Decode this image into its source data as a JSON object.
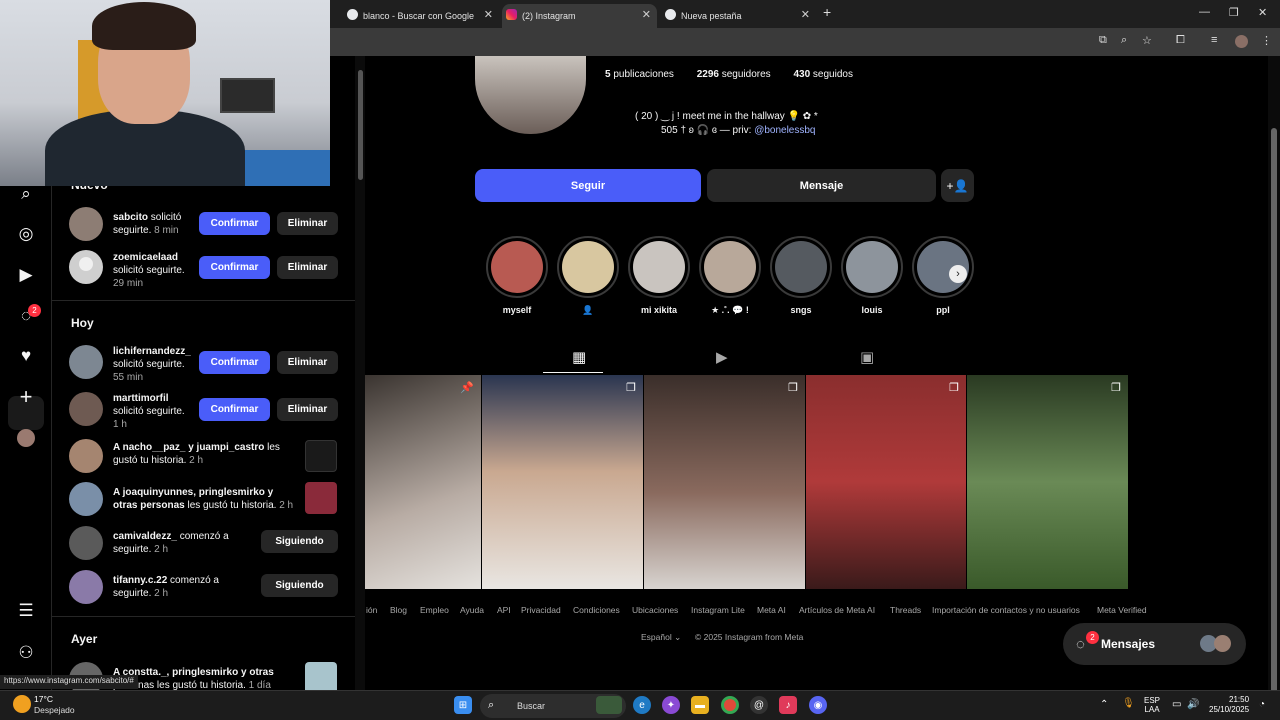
{
  "browser": {
    "tabs": [
      {
        "title": "blanco - Buscar con Google"
      },
      {
        "title": "(2) Instagram"
      },
      {
        "title": "Nueva pestaña"
      }
    ],
    "status_url": "https://www.instagram.com/sabcito/#"
  },
  "nav": {
    "notifications_badge": "2"
  },
  "panel": {
    "section_new": "Nuevo",
    "section_today": "Hoy",
    "section_yesterday": "Ayer",
    "confirm_label": "Confirmar",
    "delete_label": "Eliminar",
    "following_label": "Siguiendo",
    "new_items": [
      {
        "user": "sabcito",
        "text": " solicitó seguirte.",
        "time": " 8 min"
      },
      {
        "user": "zoemicaelaad",
        "text": " solicitó seguirte.",
        "time": "29 min"
      }
    ],
    "today_items": [
      {
        "user": "lichifernandezz_",
        "text": " solicitó seguirte.",
        "time": "55 min"
      },
      {
        "user": "marttimorfil",
        "text": " solicitó seguirte.",
        "time": "1 h"
      },
      {
        "user": "A nacho__paz_ y juampi_castro",
        "text": " les gustó tu historia.",
        "time": " 2 h"
      },
      {
        "user": "A joaquinyunnes, pringlesmirko y otras personas",
        "text": " les gustó tu historia.",
        "time": " 2 h"
      },
      {
        "user": "camivaldezz_",
        "text": " comenzó a seguirte.",
        "time": " 2 h"
      },
      {
        "user": "tifanny.c.22",
        "text": " comenzó a seguirte.",
        "time": " 2 h"
      }
    ],
    "yesterday_items": [
      {
        "user": "A constta._, pringlesmirko y otras",
        "text": " personas les gustó tu historia.",
        "time": " 1 día"
      }
    ]
  },
  "profile": {
    "posts": "5",
    "posts_label": " publicaciones",
    "followers": "2296",
    "followers_label": " seguidores",
    "following": "430",
    "following_label": " seguidos",
    "bio_line1": "( 20 ) ‿ j ! meet me in the hallway 💡 ✿ *",
    "bio_line2_prefix": "505 † ʚ 🎧 ɞ — priv: ",
    "bio_link": "@bonelessbq",
    "follow_label": "Seguir",
    "message_label": "Mensaje",
    "highlights": [
      {
        "label": "myself",
        "color": "#b85a52"
      },
      {
        "label": "👤",
        "color": "#d8c7a0"
      },
      {
        "label": "mi xikita",
        "color": "#c9c4bf"
      },
      {
        "label": "★ .˚. 💬 !",
        "color": "#b8a89a"
      },
      {
        "label": "sngs",
        "color": "#555a60"
      },
      {
        "label": "louis",
        "color": "#8d949c"
      },
      {
        "label": "ppl",
        "color": "#6a7482"
      }
    ]
  },
  "footer": {
    "links": [
      "ión",
      "Blog",
      "Empleo",
      "Ayuda",
      "API",
      "Privacidad",
      "Condiciones",
      "Ubicaciones",
      "Instagram Lite",
      "Meta AI",
      "Artículos de Meta AI",
      "Threads",
      "Importación de contactos y no usuarios",
      "Meta Verified"
    ],
    "language": "Español",
    "copyright": "© 2025 Instagram from Meta"
  },
  "messages": {
    "label": "Mensajes",
    "badge": "2"
  },
  "taskbar": {
    "temp": "17°C",
    "condition": "Despejado",
    "search": "Buscar",
    "lang1": "ESP",
    "lang2": "LAA",
    "time": "21:50",
    "date": "25/10/2025"
  }
}
